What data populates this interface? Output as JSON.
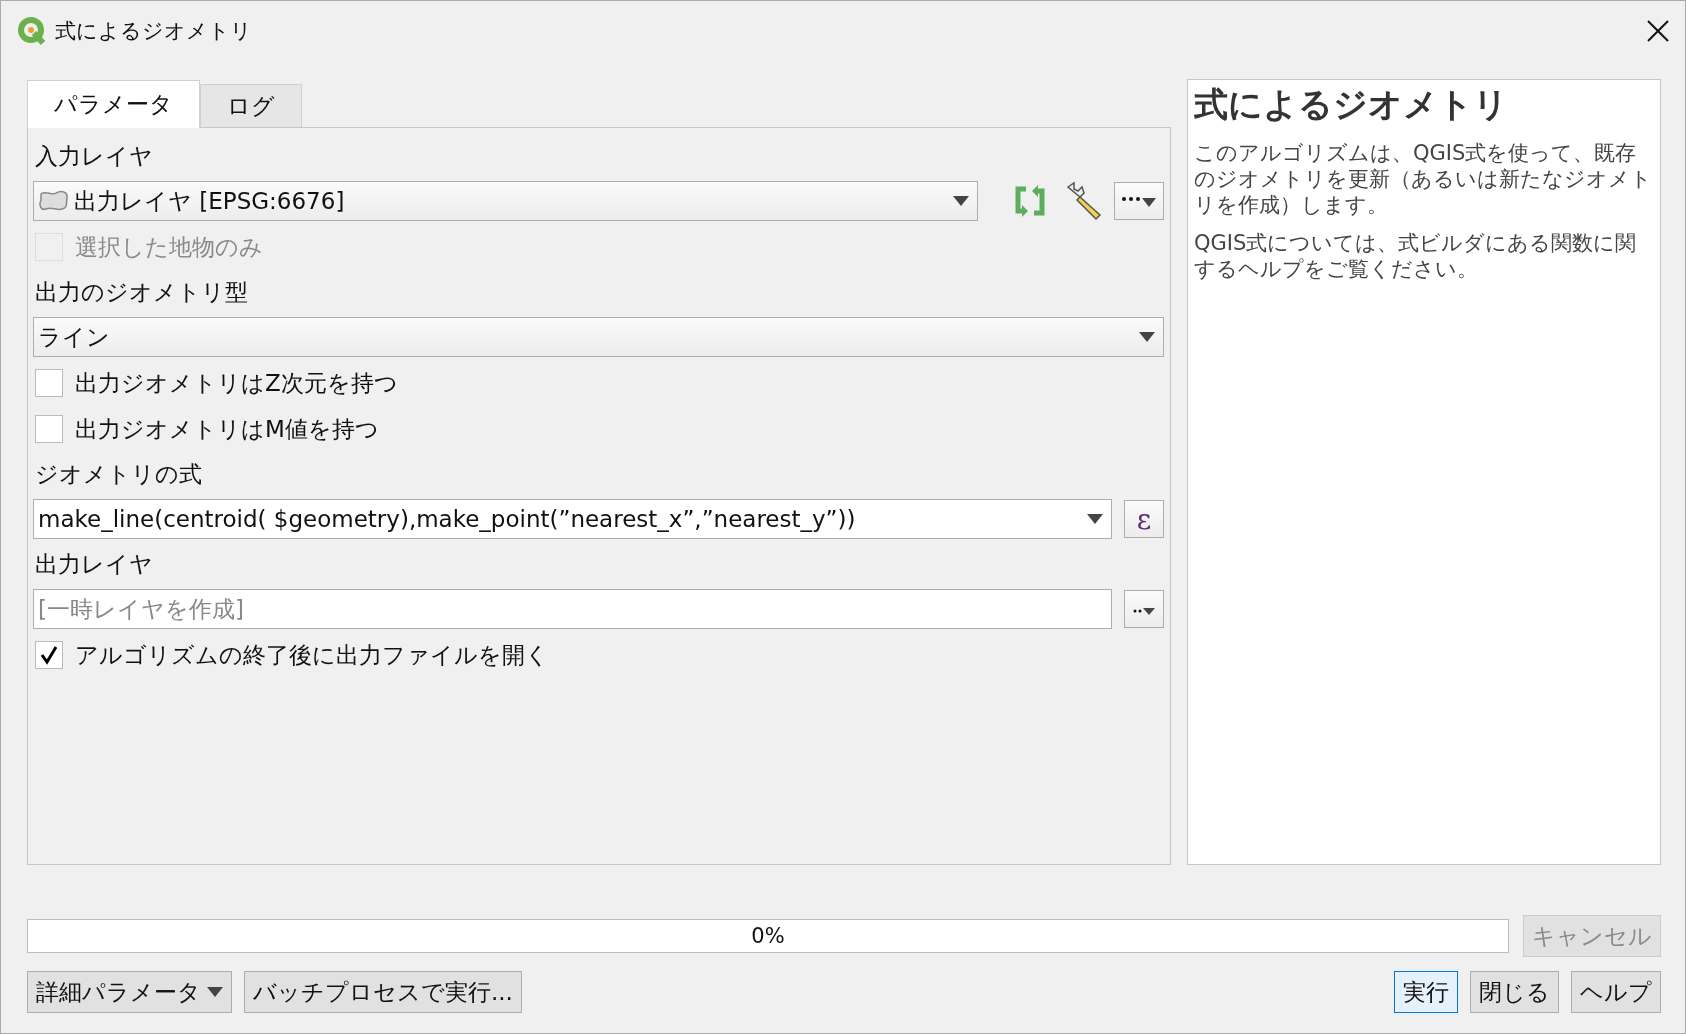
{
  "window": {
    "title": "式によるジオメトリ"
  },
  "tabs": [
    {
      "label": "パラメータ",
      "selected": true
    },
    {
      "label": "ログ",
      "selected": false
    }
  ],
  "parameters": [
    {
      "kind": "label",
      "text": "入力レイヤ"
    },
    {
      "kind": "layer_select",
      "value": "出力レイヤ [EPSG:6676]"
    },
    {
      "kind": "checkbox",
      "label": "選択した地物のみ",
      "checked": false,
      "disabled": true
    },
    {
      "kind": "label",
      "text": "出力のジオメトリ型"
    },
    {
      "kind": "select",
      "value": "ライン"
    },
    {
      "kind": "checkbox",
      "label": "出力ジオメトリはZ次元を持つ",
      "checked": false,
      "disabled": false
    },
    {
      "kind": "checkbox",
      "label": "出力ジオメトリはM値を持つ",
      "checked": false,
      "disabled": false
    },
    {
      "kind": "label",
      "text": "ジオメトリの式"
    },
    {
      "kind": "expression",
      "value": "make_line(centroid( $geometry),make_point(”nearest_x”,”nearest_y”))",
      "button": "ε"
    },
    {
      "kind": "label",
      "text": "出力レイヤ"
    },
    {
      "kind": "output",
      "placeholder": "[一時レイヤを作成]"
    },
    {
      "kind": "checkbox",
      "label": "アルゴリズムの終了後に出力ファイルを開く",
      "checked": true,
      "disabled": false
    }
  ],
  "help": {
    "title": "式によるジオメトリ",
    "paragraphs": [
      "このアルゴリズムは、QGIS式を使って、既存のジオメトリを更新（あるいは新たなジオメトリを作成）します。",
      "QGIS式については、式ビルダにある関数に関するヘルプをご覧ください。"
    ]
  },
  "progress": {
    "level": 0,
    "text": "0%"
  },
  "cancel": {
    "label": "キャンセル",
    "disabled": true
  },
  "left_buttons": [
    {
      "kind": "menu",
      "label": "詳細パラメータ"
    },
    {
      "kind": "plain",
      "label": "バッチプロセスで実行..."
    }
  ],
  "right_buttons": [
    {
      "label": "実行",
      "default": true
    },
    {
      "label": "閉じる",
      "default": false
    },
    {
      "label": "ヘルプ",
      "default": false
    }
  ]
}
